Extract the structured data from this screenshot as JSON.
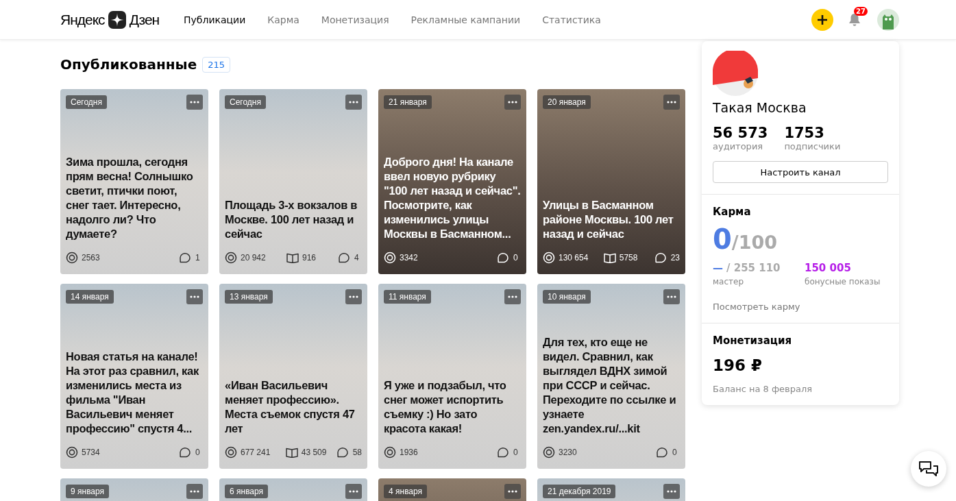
{
  "header": {
    "logo_left": "Яндекс",
    "logo_right": "Дзен",
    "tabs": [
      {
        "label": "Публикации",
        "selected": true
      },
      {
        "label": "Карма",
        "selected": false
      },
      {
        "label": "Монетизация",
        "selected": false
      },
      {
        "label": "Рекламные кампании",
        "selected": false
      },
      {
        "label": "Статистика",
        "selected": false
      }
    ],
    "notifications": "27"
  },
  "publications": {
    "title": "Опубликованные",
    "count": "215",
    "cards": [
      {
        "kind": "light",
        "date": "Сегодня",
        "title": "Зима прошла, сегодня прям весна! Солнышко светит, птички поют, снег тает. Интересно, надолго ли? Что думаете?",
        "views": "2563",
        "comments": "1"
      },
      {
        "kind": "light",
        "date": "Сегодня",
        "title": "Площадь 3-х вокзалов в Москве. 100 лет назад и сейчас",
        "views": "20 942",
        "reads": "916",
        "comments": "4"
      },
      {
        "kind": "dark",
        "date": "21 января",
        "title": "Доброго дня! На канале ввел новую рубрику \"100 лет назад и сейчас\". Посмотрите, как изменились улицы Москвы в Басманном...",
        "views": "3342",
        "comments": "0"
      },
      {
        "kind": "dark",
        "date": "20 января",
        "title": "Улицы в Басманном районе Москвы. 100 лет назад и сейчас",
        "views": "130 654",
        "reads": "5758",
        "comments": "23"
      },
      {
        "kind": "light",
        "date": "14 января",
        "title": "Новая статья на канале! На этот раз сравнил, как изменились места из фильма \"Иван Васильевич меняет профессию\" спустя 4...",
        "views": "5734",
        "comments": "0"
      },
      {
        "kind": "light",
        "date": "13 января",
        "title": "«Иван Васильевич меняет профессию». Места съемок спустя 47 лет",
        "views": "677 241",
        "reads": "43 509",
        "comments": "58"
      },
      {
        "kind": "light",
        "date": "11 января",
        "title": "Я уже и подзабыл, что снег может испортить съемку :) Но зато красота какая!",
        "views": "1936",
        "comments": "0"
      },
      {
        "kind": "light",
        "date": "10 января",
        "title": "Для тех, кто еще не видел. Сравнил, как выглядел ВДНХ зимой при СССР и сейчас. Переходите по ссылке и узнаете zen.yandex.ru/...kit",
        "views": "3230",
        "comments": "0"
      },
      {
        "kind": "light",
        "date": "9 января"
      },
      {
        "kind": "light",
        "date": "6 января"
      },
      {
        "kind": "dark",
        "date": "4 января"
      },
      {
        "kind": "light",
        "date": "21 декабря 2019"
      }
    ]
  },
  "channel": {
    "name": "Такая Москва",
    "stats": [
      {
        "value": "56 573",
        "label": "аудитория"
      },
      {
        "value": "1753",
        "label": "подписчики"
      }
    ],
    "setup_button": "Настроить канал",
    "karma": {
      "title": "Карма",
      "value": "0",
      "max": "/100",
      "master_value": "—",
      "master_rest": "/ 255 110",
      "master_label": "мастер",
      "bonus_value": "150 005",
      "bonus_label": "бонусные показы",
      "link": "Посмотреть карму"
    },
    "monetization": {
      "title": "Монетизация",
      "amount": "196 ₽",
      "note": "Баланс на 8 февраля"
    }
  }
}
